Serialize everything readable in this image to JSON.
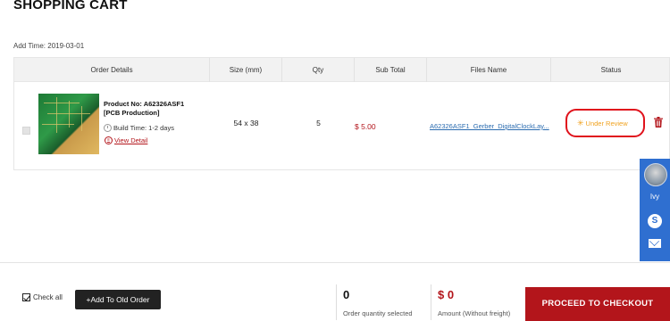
{
  "page": {
    "title": "SHOPPING CART",
    "add_time": "Add Time: 2019-03-01"
  },
  "table": {
    "headers": [
      "Order Details",
      "Size (mm)",
      "Qty",
      "Sub Total",
      "Files Name",
      "Status"
    ],
    "rows": [
      {
        "product_no": "Product No: A62326ASF1",
        "product_type": "[PCB Production]",
        "build_time": "Build Time: 1-2 days",
        "view_detail": "View Detail",
        "size": "54 x 38",
        "qty": "5",
        "subtotal": "$ 5.00",
        "file_name": "A62326ASF1_Gerber_DigitalClockLay...",
        "status": "Under Review",
        "status_color": "#f0a21f"
      }
    ]
  },
  "side_panel": {
    "agent_name": "Ivy",
    "icons": [
      "avatar",
      "skype-icon",
      "mail-icon"
    ]
  },
  "footer": {
    "check_all_label": "Check all",
    "add_old_order_label": "+Add To Old Order",
    "order_quantity_value": "0",
    "order_quantity_label": "Order quantity selected",
    "amount_value": "$ 0",
    "amount_label": "Amount (Without freight)",
    "checkout_label": "PROCEED TO CHECKOUT"
  },
  "colors": {
    "accent_red": "#b3151b",
    "highlight_red": "#e0121c",
    "side_blue": "#2f6fd0"
  }
}
